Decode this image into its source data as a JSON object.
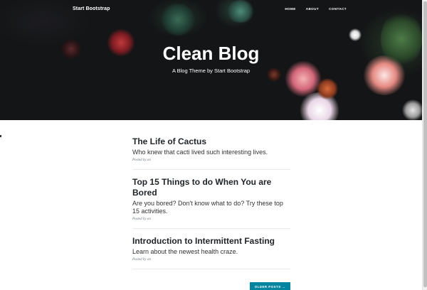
{
  "navbar": {
    "brand": "Start Bootstrap",
    "links": [
      "HOME",
      "ABOUT",
      "CONTACT"
    ]
  },
  "header": {
    "title": "Clean Blog",
    "subtitle": "A Blog Theme by Start Bootstrap"
  },
  "posts": [
    {
      "title": "The Life of Cactus",
      "subtitle": "Who knew that cacti lived such interesting lives.",
      "meta": "Posted by on"
    },
    {
      "title": "Top 15 Things to do When You are Bored",
      "subtitle": "Are you bored? Don't know what to do? Try these top 15 activities.",
      "meta": "Posted by on"
    },
    {
      "title": "Introduction to Intermittent Fasting",
      "subtitle": "Learn about the newest health craze.",
      "meta": "Posted by on"
    }
  ],
  "pager": {
    "older_label": "OLDER POSTS →"
  },
  "colors": {
    "accent": "#0085a1",
    "header_bg": "#141516",
    "text": "#212529"
  }
}
